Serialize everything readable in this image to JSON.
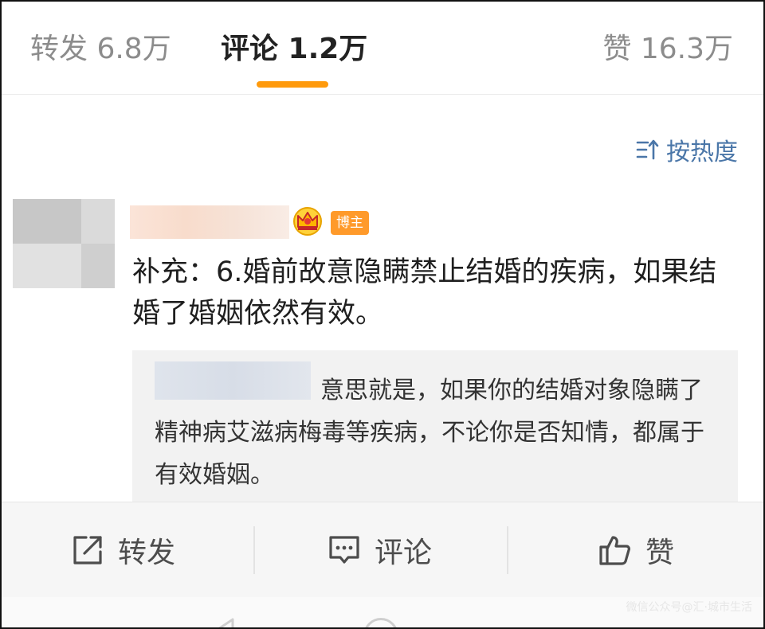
{
  "tabs": {
    "repost": "转发 6.8万",
    "comments": "评论 1.2万",
    "likes": "赞 16.3万",
    "active_color": "#ff9a0c"
  },
  "sort": {
    "label": "按热度",
    "icon": "sort-icon",
    "color": "#4a76a8"
  },
  "comment": {
    "badge": "博主",
    "badge_icon": "crown-icon",
    "text": "补充：6.婚前故意隐瞒禁止结婚的疾病，如果结婚了婚姻依然有效。",
    "reply": {
      "text": "意思就是，如果你的结婚对象隐瞒了精神病艾滋病梅毒等疾病，不论你是否知情，都属于有效婚姻。"
    }
  },
  "actions": {
    "repost": {
      "label": "转发",
      "icon": "share-icon"
    },
    "comment": {
      "label": "评论",
      "icon": "comment-icon"
    },
    "like": {
      "label": "赞",
      "icon": "thumbs-up-icon"
    }
  },
  "watermark": "微信公众号@汇·城市生活"
}
